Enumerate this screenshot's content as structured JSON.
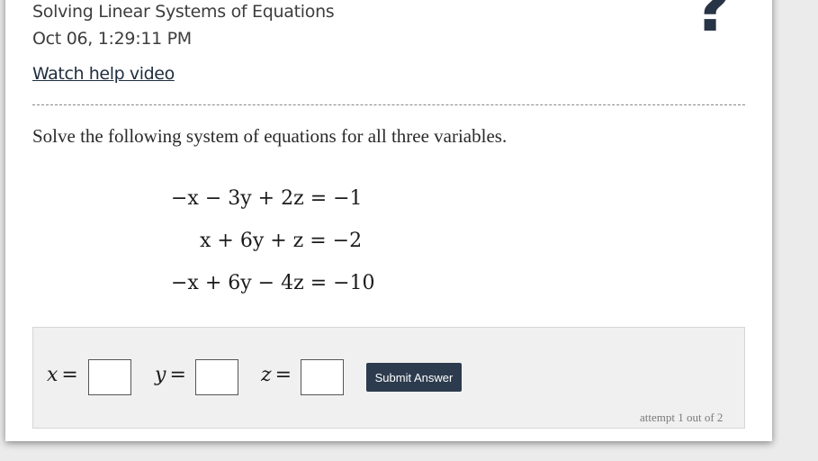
{
  "header": {
    "title": "Solving Linear Systems of Equations",
    "timestamp": "Oct 06, 1:29:11 PM",
    "help_link": "Watch help video",
    "help_icon": "?"
  },
  "question": {
    "prompt": "Solve the following system of equations for all three variables.",
    "equations": [
      "−x − 3y + 2z = −1",
      "x + 6y + z = −2",
      "−x + 6y − 4z = −10"
    ]
  },
  "answer": {
    "x_label": "x",
    "y_label": "y",
    "z_label": "z",
    "equals": "=",
    "x_value": "",
    "y_value": "",
    "z_value": "",
    "submit_label": "Submit Answer",
    "attempt_text": "attempt 1 out of 2"
  },
  "colors": {
    "button": "#2c3b4d",
    "help_icon": "#273446",
    "panel": "#f0f0f0"
  }
}
